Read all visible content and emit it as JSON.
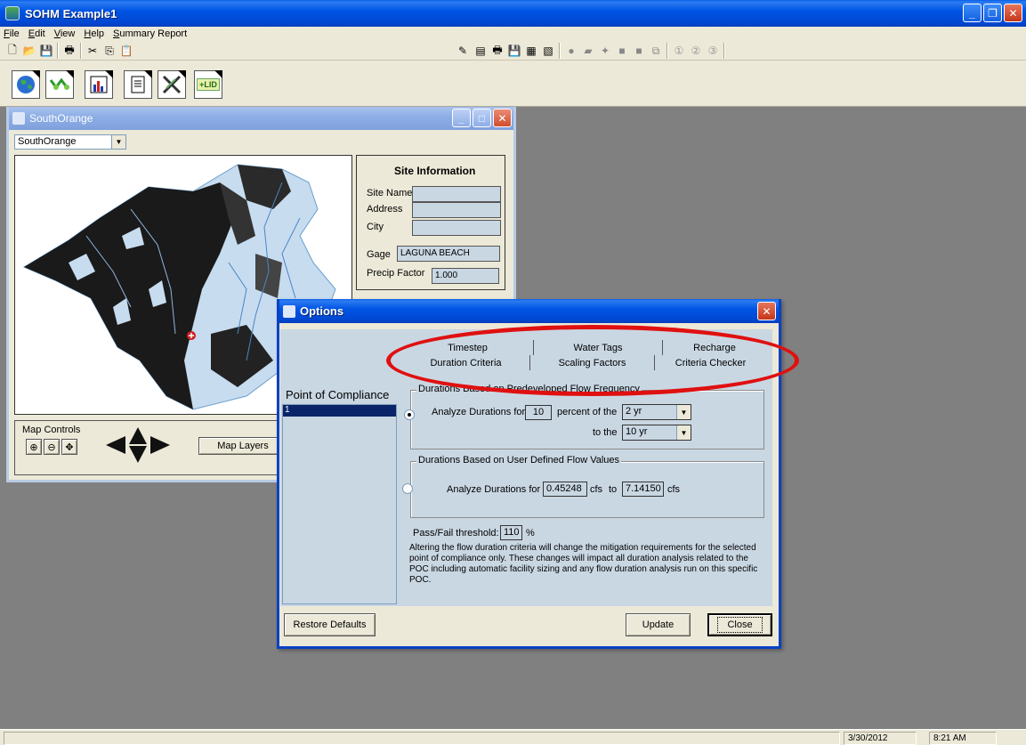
{
  "app": {
    "title": "SOHM  Example1",
    "menu": [
      "File",
      "Edit",
      "View",
      "Help",
      "Summary Report"
    ]
  },
  "toolbar_icons": [
    "new-file-icon",
    "open-folder-icon",
    "save-icon",
    "print-icon",
    "cut-icon",
    "copy-icon",
    "paste-icon"
  ],
  "main_buttons": [
    "globe-icon",
    "network-icon",
    "chart-icon",
    "report-icon",
    "tools-icon",
    "lid-icon"
  ],
  "lid_label": "+LID",
  "child": {
    "title": "SouthOrange",
    "selector_value": "SouthOrange",
    "site_info": {
      "heading": "Site Information",
      "site_name_label": "Site Name",
      "address_label": "Address",
      "city_label": "City",
      "gage_label": "Gage",
      "gage_value": "LAGUNA BEACH",
      "precip_label": "Precip Factor",
      "precip_value": "1.000"
    },
    "map_controls_label": "Map Controls",
    "map_layers_label": "Map Layers"
  },
  "dialog": {
    "title": "Options",
    "poc_label": "Point of Compliance",
    "poc_items": [
      "1"
    ],
    "tabs_row1": [
      "Timestep",
      "Water Tags",
      "Recharge"
    ],
    "tabs_row2": [
      "Duration Criteria",
      "Scaling Factors",
      "Criteria Checker"
    ],
    "group1_label": "Durations Based on Predeveloped Flow Frequency",
    "analyze_for": "Analyze Durations for",
    "percent_value": "10",
    "percent_of": "percent of the",
    "from_select": "2 yr",
    "to_the": "to the",
    "to_select": "10 yr",
    "group2_label": "Durations Based on User Defined Flow Values",
    "analyze_for2": "Analyze Durations for",
    "flow_low": "0.45248",
    "cfs1": "cfs",
    "to": "to",
    "flow_high": "7.14150",
    "cfs2": "cfs",
    "threshold_label": "Pass/Fail threshold:",
    "threshold_value": "110",
    "threshold_unit": "%",
    "note": "Altering the flow duration criteria will change the mitigation requirements for the selected point of compliance only.  These changes will impact all duration analysis related to the POC including automatic facility sizing and any flow duration analysis run on this specific POC.",
    "restore_label": "Restore Defaults",
    "update_label": "Update",
    "close_label": "Close"
  },
  "status": {
    "date": "3/30/2012",
    "time": "8:21 AM"
  },
  "colors": {
    "highlight": "#e01010",
    "panel": "#c9d7e3"
  }
}
